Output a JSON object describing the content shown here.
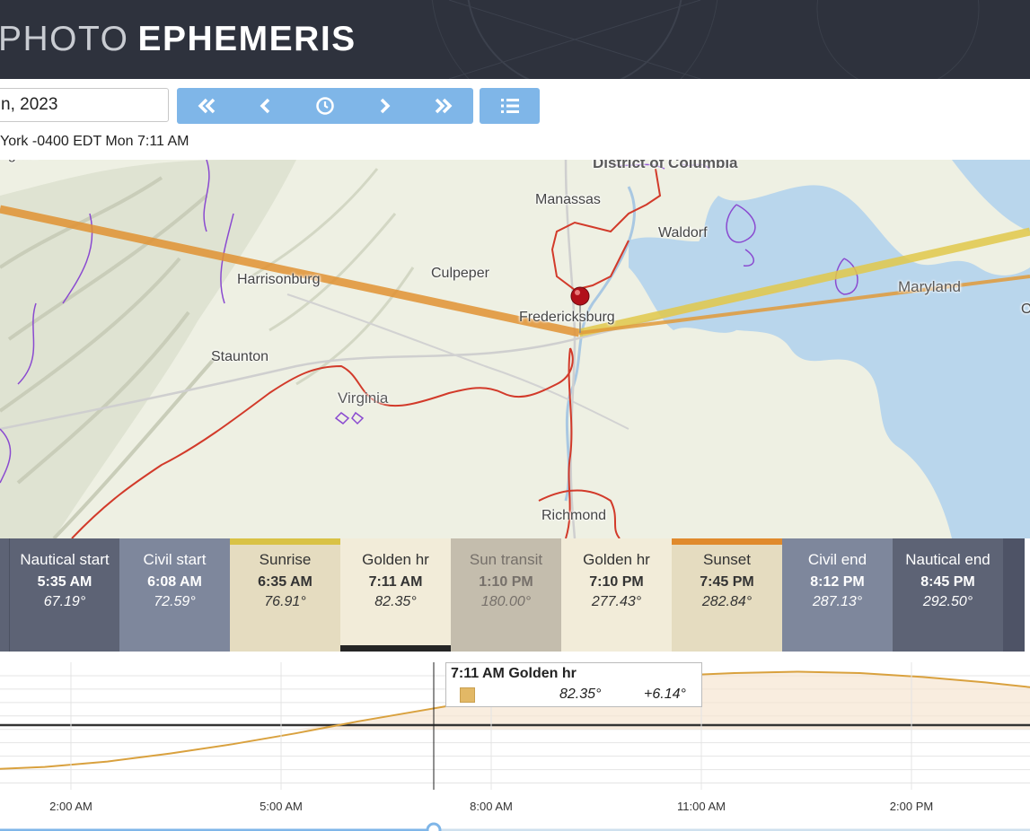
{
  "brand": {
    "light": "PHOTO",
    "bold": "EPHEMERIS"
  },
  "toolbar": {
    "date_value": "n, 2023",
    "timezone_line": "York -0400 EDT Mon 7:11 AM",
    "accent_color": "#7fb6e8"
  },
  "map": {
    "labels": {
      "district": "District of Columbia",
      "manassas": "Manassas",
      "waldorf": "Waldorf",
      "culpeper": "Culpeper",
      "harrisonburg": "Harrisonburg",
      "fredericksburg": "Fredericksburg",
      "maryland": "Maryland",
      "staunton": "Staunton",
      "virginia": "Virginia",
      "richmond": "Richmond",
      "virginia_partial": "irginia",
      "o_partial": "O"
    }
  },
  "events": [
    {
      "name": "Nautical start",
      "time": "5:35 AM",
      "azimuth": "67.19°"
    },
    {
      "name": "Civil start",
      "time": "6:08 AM",
      "azimuth": "72.59°"
    },
    {
      "name": "Sunrise",
      "time": "6:35 AM",
      "azimuth": "76.91°"
    },
    {
      "name": "Golden hr",
      "time": "7:11 AM",
      "azimuth": "82.35°"
    },
    {
      "name": "Sun transit",
      "time": "1:10 PM",
      "azimuth": "180.00°"
    },
    {
      "name": "Golden hr",
      "time": "7:10 PM",
      "azimuth": "277.43°"
    },
    {
      "name": "Sunset",
      "time": "7:45 PM",
      "azimuth": "282.84°"
    },
    {
      "name": "Civil end",
      "time": "8:12 PM",
      "azimuth": "287.13°"
    },
    {
      "name": "Nautical end",
      "time": "8:45 PM",
      "azimuth": "292.50°"
    }
  ],
  "tooltip": {
    "title": "7:11 AM Golden hr",
    "azimuth": "82.35°",
    "altitude": "+6.14°"
  },
  "chart_data": {
    "type": "line",
    "x_ticks": [
      "2:00 AM",
      "5:00 AM",
      "8:00 AM",
      "11:00 AM",
      "2:00 PM"
    ],
    "x": [
      0,
      1,
      2,
      3,
      4,
      5,
      6,
      7,
      8,
      9,
      10,
      11,
      12,
      13,
      14,
      15,
      16,
      17
    ],
    "y": [
      -30,
      -28,
      -24,
      -18,
      -11,
      -3,
      6,
      14,
      22,
      30,
      36,
      40,
      42,
      43,
      42,
      39,
      35,
      30
    ],
    "cursor_time": "7:11 AM",
    "series_color": "#d9a13e"
  }
}
